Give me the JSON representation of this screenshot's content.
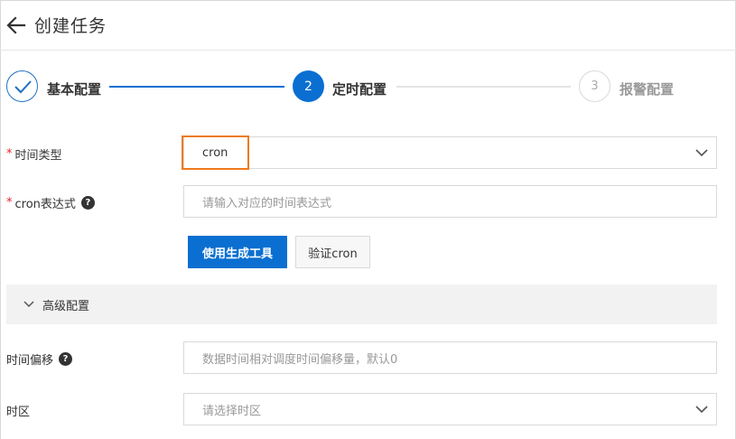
{
  "header": {
    "back_icon": "arrow-left-icon",
    "title": "创建任务"
  },
  "steps": [
    {
      "label": "基本配置",
      "state": "done",
      "icon": "check-icon"
    },
    {
      "label": "定时配置",
      "state": "active",
      "number": "2"
    },
    {
      "label": "报警配置",
      "state": "pending",
      "number": "3"
    }
  ],
  "form": {
    "time_type": {
      "required_mark": "*",
      "label": "时间类型",
      "value": "cron",
      "icon": "chevron-down-icon"
    },
    "cron_expr": {
      "required_mark": "*",
      "label": "cron表达式",
      "help": "?",
      "placeholder": "请输入对应的时间表达式"
    },
    "buttons": {
      "generate": "使用生成工具",
      "verify": "验证cron"
    },
    "advanced": {
      "label": "高级配置",
      "icon": "chevron-down-icon"
    },
    "time_offset": {
      "label": "时间偏移",
      "help": "?",
      "placeholder": "数据时间相对调度时间偏移量，默认0"
    },
    "timezone": {
      "label": "时区",
      "placeholder": "请选择时区",
      "icon": "chevron-down-icon"
    }
  },
  "colors": {
    "primary": "#0a6fd1",
    "highlight": "#ee7a1e",
    "required": "#e2262b"
  }
}
